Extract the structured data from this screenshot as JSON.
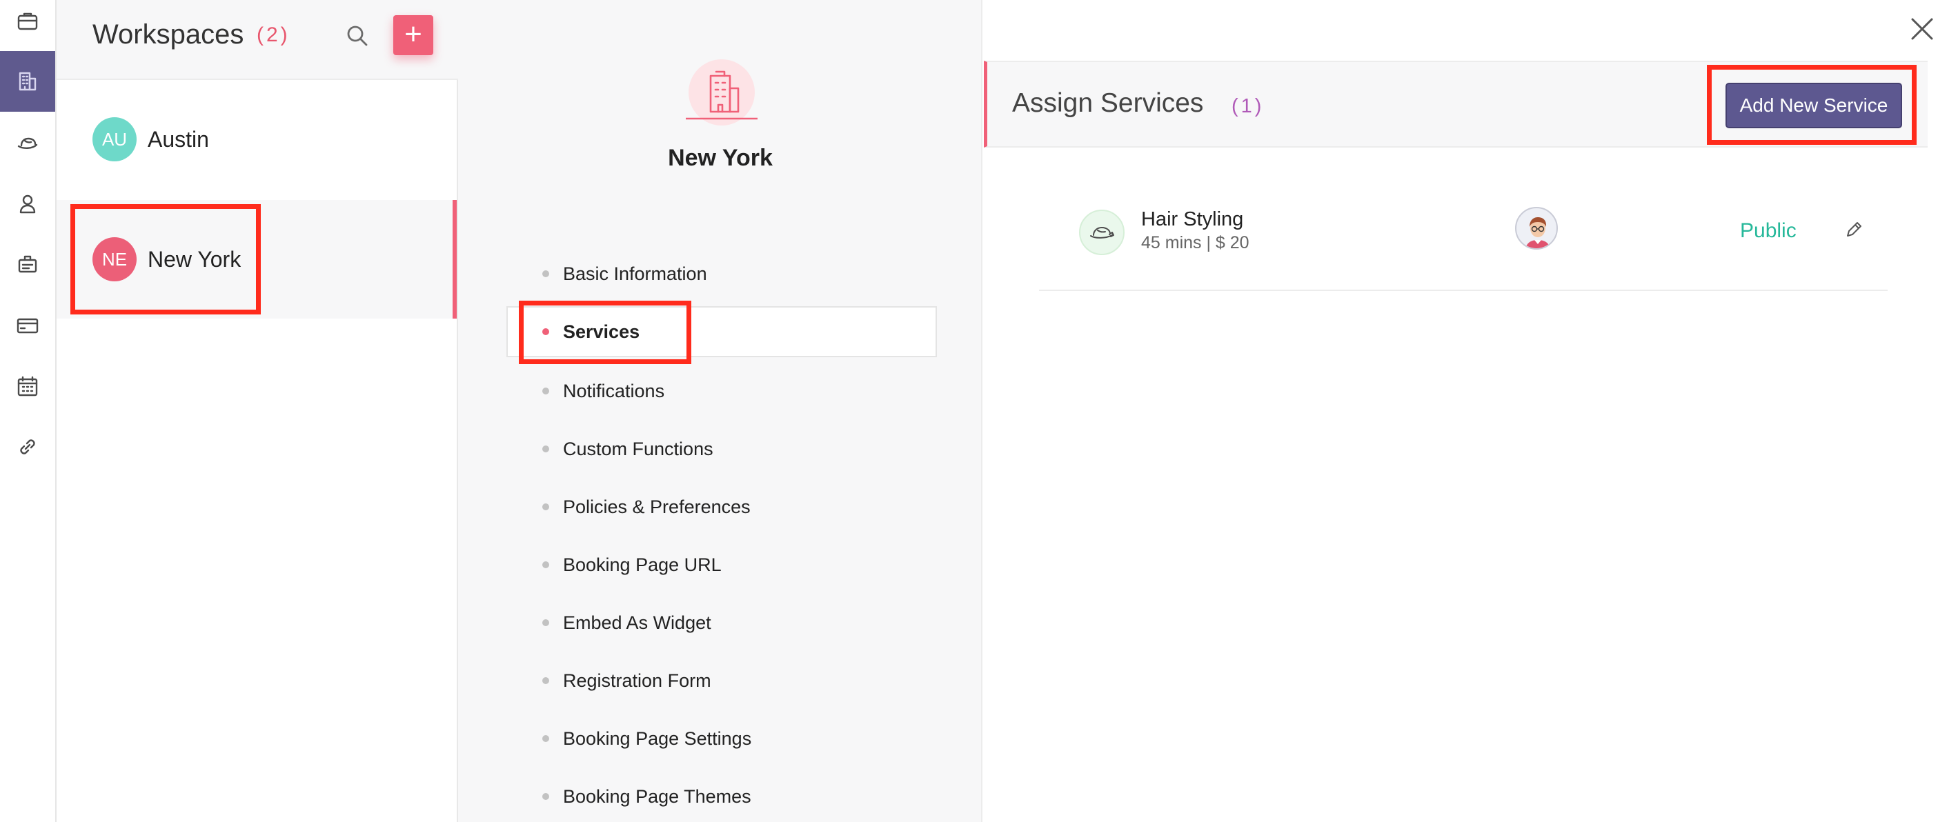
{
  "rail": {
    "items": [
      {
        "icon": "briefcase-icon"
      },
      {
        "icon": "building-icon",
        "active": true
      },
      {
        "icon": "hat-icon"
      },
      {
        "icon": "person-icon"
      },
      {
        "icon": "id-badge-icon"
      },
      {
        "icon": "credit-card-icon"
      },
      {
        "icon": "calendar-icon"
      },
      {
        "icon": "link-icon"
      }
    ]
  },
  "workspaces": {
    "title": "Workspaces",
    "count": "(2)",
    "items": [
      {
        "initials": "AU",
        "name": "Austin",
        "color": "#6ed9c9"
      },
      {
        "initials": "NE",
        "name": "New York",
        "color": "#ec5f78",
        "selected": true
      }
    ]
  },
  "location": {
    "name": "New York",
    "menu": [
      {
        "label": "Basic Information"
      },
      {
        "label": "Services",
        "active": true
      },
      {
        "label": "Notifications"
      },
      {
        "label": "Custom Functions"
      },
      {
        "label": "Policies & Preferences"
      },
      {
        "label": "Booking Page URL"
      },
      {
        "label": "Embed As Widget"
      },
      {
        "label": "Registration Form"
      },
      {
        "label": "Booking Page Settings"
      },
      {
        "label": "Booking Page Themes"
      }
    ]
  },
  "assign_services": {
    "title": "Assign Services",
    "count": "(1)",
    "add_button_label": "Add New Service",
    "services": [
      {
        "name": "Hair Styling",
        "meta": "45 mins | $ 20",
        "status": "Public",
        "icon": "hat-icon",
        "staff_icon": "staff-avatar-icon"
      }
    ]
  },
  "colors": {
    "accent": "#f06078",
    "brand": "#5f5a8e",
    "public": "#26b89a",
    "highlight": "#ff2b1c"
  }
}
